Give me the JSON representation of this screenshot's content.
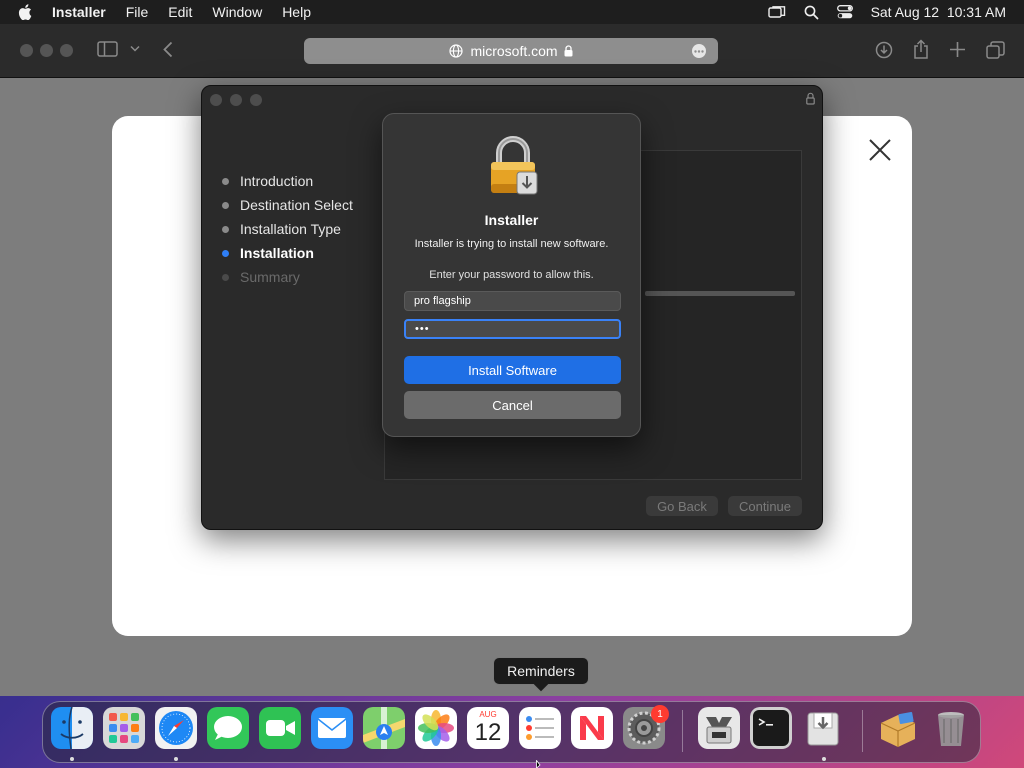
{
  "menubar": {
    "app_name": "Installer",
    "menus": [
      "File",
      "Edit",
      "Window",
      "Help"
    ],
    "clock": "Sat Aug 12  10:31 AM"
  },
  "browser": {
    "url": "microsoft.com"
  },
  "installer": {
    "steps": [
      {
        "label": "Introduction",
        "state": "done"
      },
      {
        "label": "Destination Select",
        "state": "done"
      },
      {
        "label": "Installation Type",
        "state": "done"
      },
      {
        "label": "Installation",
        "state": "active"
      },
      {
        "label": "Summary",
        "state": "pending"
      }
    ],
    "go_back": "Go Back",
    "continue": "Continue"
  },
  "auth_dialog": {
    "title": "Installer",
    "message": "Installer is trying to install new software.",
    "prompt": "Enter your password to allow this.",
    "username": "pro flagship",
    "password_mask": "•••",
    "install_button": "Install Software",
    "cancel_button": "Cancel"
  },
  "tooltip": "Reminders",
  "dock": {
    "apps": [
      "Finder",
      "Launchpad",
      "Safari",
      "Messages",
      "FaceTime",
      "Mail",
      "Maps",
      "Photos",
      "Calendar",
      "Reminders",
      "News",
      "System Settings",
      "Archive Utility",
      "Terminal",
      "Installer",
      "Utilities",
      "Trash"
    ],
    "calendar_month": "AUG",
    "calendar_day": "12",
    "settings_badge": "1"
  },
  "colors": {
    "accent": "#1f6fe5",
    "focus_ring": "#3a82f7",
    "badge": "#ff3b30"
  }
}
